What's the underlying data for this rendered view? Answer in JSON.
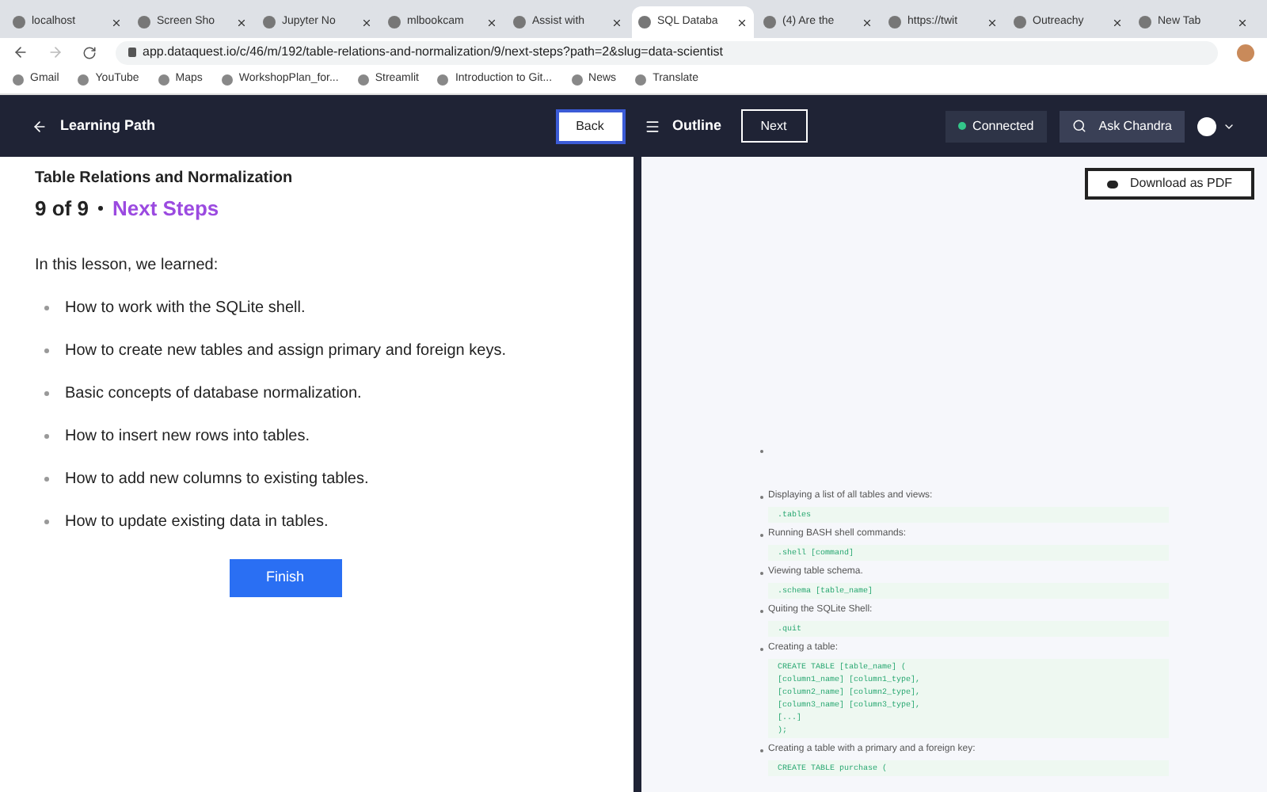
{
  "browser": {
    "tabs": [
      {
        "title": "localhost",
        "selected": false
      },
      {
        "title": "Screen Sho",
        "selected": false
      },
      {
        "title": "Jupyter No",
        "selected": false
      },
      {
        "title": "mlbookcam",
        "selected": false
      },
      {
        "title": "Assist with",
        "selected": false
      },
      {
        "title": "SQL Databa",
        "selected": true
      },
      {
        "title": "(4) Are the",
        "selected": false
      },
      {
        "title": "https://twit",
        "selected": false
      },
      {
        "title": "Outreachy",
        "selected": false
      },
      {
        "title": "New Tab",
        "selected": false
      }
    ],
    "url": "app.dataquest.io/c/46/m/192/table-relations-and-normalization/9/next-steps?path=2&slug=data-scientist",
    "bookmarks": [
      "Gmail",
      "YouTube",
      "Maps",
      "WorkshopPlan_for...",
      "Streamlit",
      "Introduction to Git...",
      "News",
      "Translate"
    ]
  },
  "header": {
    "learning_path": "Learning Path",
    "back": "Back",
    "outline": "Outline",
    "next": "Next",
    "status": "Connected",
    "connected": true,
    "ask": "Ask Chandra"
  },
  "lesson": {
    "course": "Table Relations and Normalization",
    "progress": "9 of 9",
    "step": "Next Steps",
    "intro": "In this lesson, we learned:",
    "points": [
      "How to work with the SQLite shell.",
      "How to create new tables and assign primary and foreign keys.",
      "Basic concepts of database normalization.",
      "How to insert new rows into tables.",
      "How to add new columns to existing tables.",
      "How to update existing data in tables."
    ],
    "finish": "Finish"
  },
  "document": {
    "download": "Download as PDF",
    "items": [
      {
        "label": "Displaying a list of all tables and views:",
        "code": [
          ".tables"
        ]
      },
      {
        "label": "Running BASH shell commands:",
        "code": [
          ".shell [command]"
        ]
      },
      {
        "label": "Viewing table schema.",
        "code": [
          ".schema [table_name]"
        ]
      },
      {
        "label": "Quiting the SQLite Shell:",
        "code": [
          ".quit"
        ]
      },
      {
        "label": "Creating a table:",
        "code": [
          "CREATE TABLE [table_name] (",
          "[column1_name] [column1_type],",
          "[column2_name] [column2_type],",
          "[column3_name] [column3_type],",
          "[...]",
          ");"
        ]
      },
      {
        "label": "Creating a table with a primary and a foreign key:",
        "code": [
          "CREATE TABLE purchase ("
        ]
      }
    ]
  }
}
